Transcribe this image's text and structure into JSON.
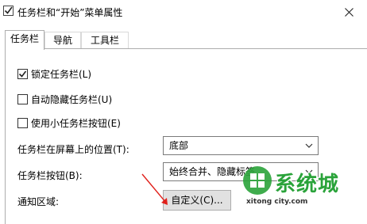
{
  "window": {
    "title": "任务栏和“开始”菜单属性"
  },
  "tabs": [
    {
      "label": "任务栏",
      "active": true
    },
    {
      "label": "导航",
      "active": false
    },
    {
      "label": "工具栏",
      "active": false
    }
  ],
  "options": {
    "lock_taskbar": {
      "label": "锁定任务栏(L)",
      "checked": true
    },
    "auto_hide": {
      "label": "自动隐藏任务栏(U)",
      "checked": false
    },
    "small_buttons": {
      "label": "使用小任务栏按钮(E)",
      "checked": false
    }
  },
  "fields": {
    "position": {
      "label": "任务栏在屏幕上的位置(T):",
      "value": "底部"
    },
    "buttons": {
      "label": "任务栏按钮(B):",
      "value": "始终合并、隐藏标签"
    },
    "notification": {
      "label": "通知区域:",
      "button_label": "自定义(C)..."
    }
  },
  "watermark": {
    "text": "系统城",
    "url": "xitong city.com"
  },
  "colors": {
    "annotation_arrow": "#e0201b",
    "watermark_green": "#2aa33a"
  }
}
